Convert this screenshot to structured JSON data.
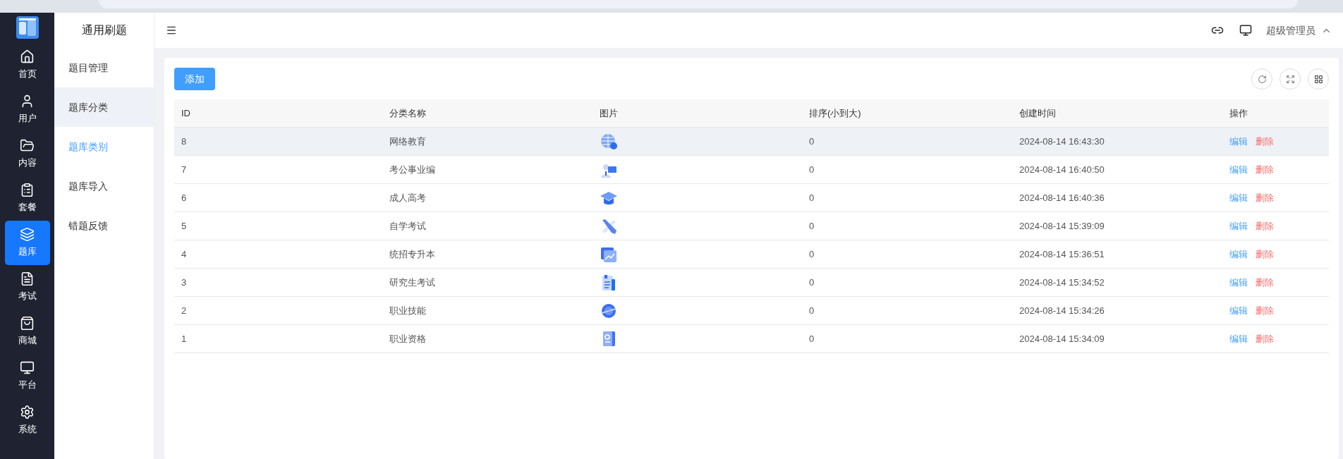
{
  "nav": [
    {
      "label": "首页",
      "selected": false
    },
    {
      "label": "用户",
      "selected": false
    },
    {
      "label": "内容",
      "selected": false
    },
    {
      "label": "套餐",
      "selected": false
    },
    {
      "label": "题库",
      "selected": true
    },
    {
      "label": "考试",
      "selected": false
    },
    {
      "label": "商城",
      "selected": false
    },
    {
      "label": "平台",
      "selected": false
    },
    {
      "label": "系统",
      "selected": false
    }
  ],
  "submenu": {
    "title": "通用刷题",
    "items": [
      {
        "label": "题目管理",
        "selected": false,
        "highlighted": false
      },
      {
        "label": "题库分类",
        "selected": false,
        "highlighted": true
      },
      {
        "label": "题库类别",
        "selected": true,
        "highlighted": false
      },
      {
        "label": "题库导入",
        "selected": false,
        "highlighted": false
      },
      {
        "label": "错题反馈",
        "selected": false,
        "highlighted": false
      }
    ]
  },
  "header": {
    "user": "超级管理员"
  },
  "add_button": "添加",
  "table": {
    "columns": [
      "ID",
      "分类名称",
      "图片",
      "排序(小到大)",
      "创建时间",
      "操作"
    ],
    "rows": [
      {
        "id": "8",
        "name": "网络教育",
        "sort": "0",
        "created": "2024-08-14 16:43:30",
        "edit": "编辑",
        "delete": "删除",
        "highlighted": true
      },
      {
        "id": "7",
        "name": "考公事业编",
        "sort": "0",
        "created": "2024-08-14 16:40:50",
        "edit": "编辑",
        "delete": "删除",
        "highlighted": false
      },
      {
        "id": "6",
        "name": "成人高考",
        "sort": "0",
        "created": "2024-08-14 16:40:36",
        "edit": "编辑",
        "delete": "删除",
        "highlighted": false
      },
      {
        "id": "5",
        "name": "自学考试",
        "sort": "0",
        "created": "2024-08-14 15:39:09",
        "edit": "编辑",
        "delete": "删除",
        "highlighted": false
      },
      {
        "id": "4",
        "name": "统招专升本",
        "sort": "0",
        "created": "2024-08-14 15:36:51",
        "edit": "编辑",
        "delete": "删除",
        "highlighted": false
      },
      {
        "id": "3",
        "name": "研究生考试",
        "sort": "0",
        "created": "2024-08-14 15:34:52",
        "edit": "编辑",
        "delete": "删除",
        "highlighted": false
      },
      {
        "id": "2",
        "name": "职业技能",
        "sort": "0",
        "created": "2024-08-14 15:34:26",
        "edit": "编辑",
        "delete": "删除",
        "highlighted": false
      },
      {
        "id": "1",
        "name": "职业资格",
        "sort": "0",
        "created": "2024-08-14 15:34:09",
        "edit": "编辑",
        "delete": "删除",
        "highlighted": false
      }
    ]
  }
}
